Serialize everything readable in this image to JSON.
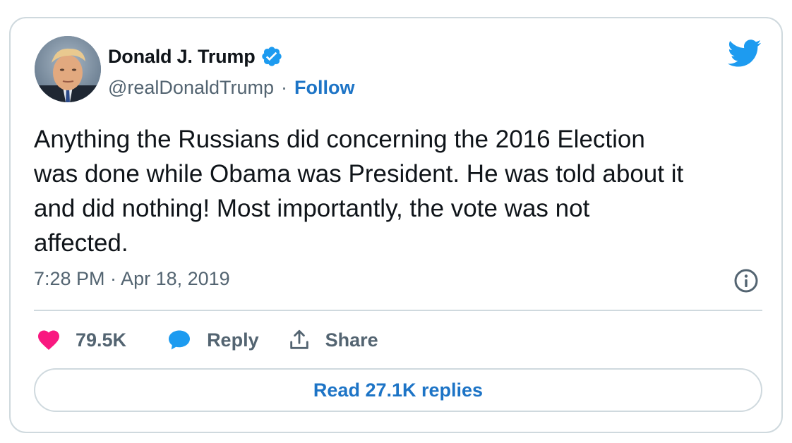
{
  "author": {
    "name": "Donald J. Trump",
    "handle": "@realDonaldTrump",
    "separator": "·",
    "follow_label": "Follow",
    "verified": true
  },
  "tweet": {
    "text": "Anything the Russians did concerning the 2016 Election\nwas done while Obama was President. He was told about it\nand did nothing! Most importantly, the vote was not\naffected.",
    "timestamp": "7:28 PM · Apr 18, 2019"
  },
  "actions": {
    "like_count": "79.5K",
    "reply_label": "Reply",
    "share_label": "Share"
  },
  "read_replies_label": "Read 27.1K replies",
  "icons": {
    "brand": "twitter-bird-icon",
    "verified": "verified-badge-icon",
    "info": "info-icon",
    "like": "heart-icon",
    "reply": "speech-bubble-icon",
    "share": "share-upload-icon"
  },
  "colors": {
    "brand_blue": "#1d9bf0",
    "link_blue": "#1d74c6",
    "like_pink": "#f91880",
    "text_dark": "#0f1419",
    "text_muted": "#536471",
    "border": "#cfd9de"
  }
}
